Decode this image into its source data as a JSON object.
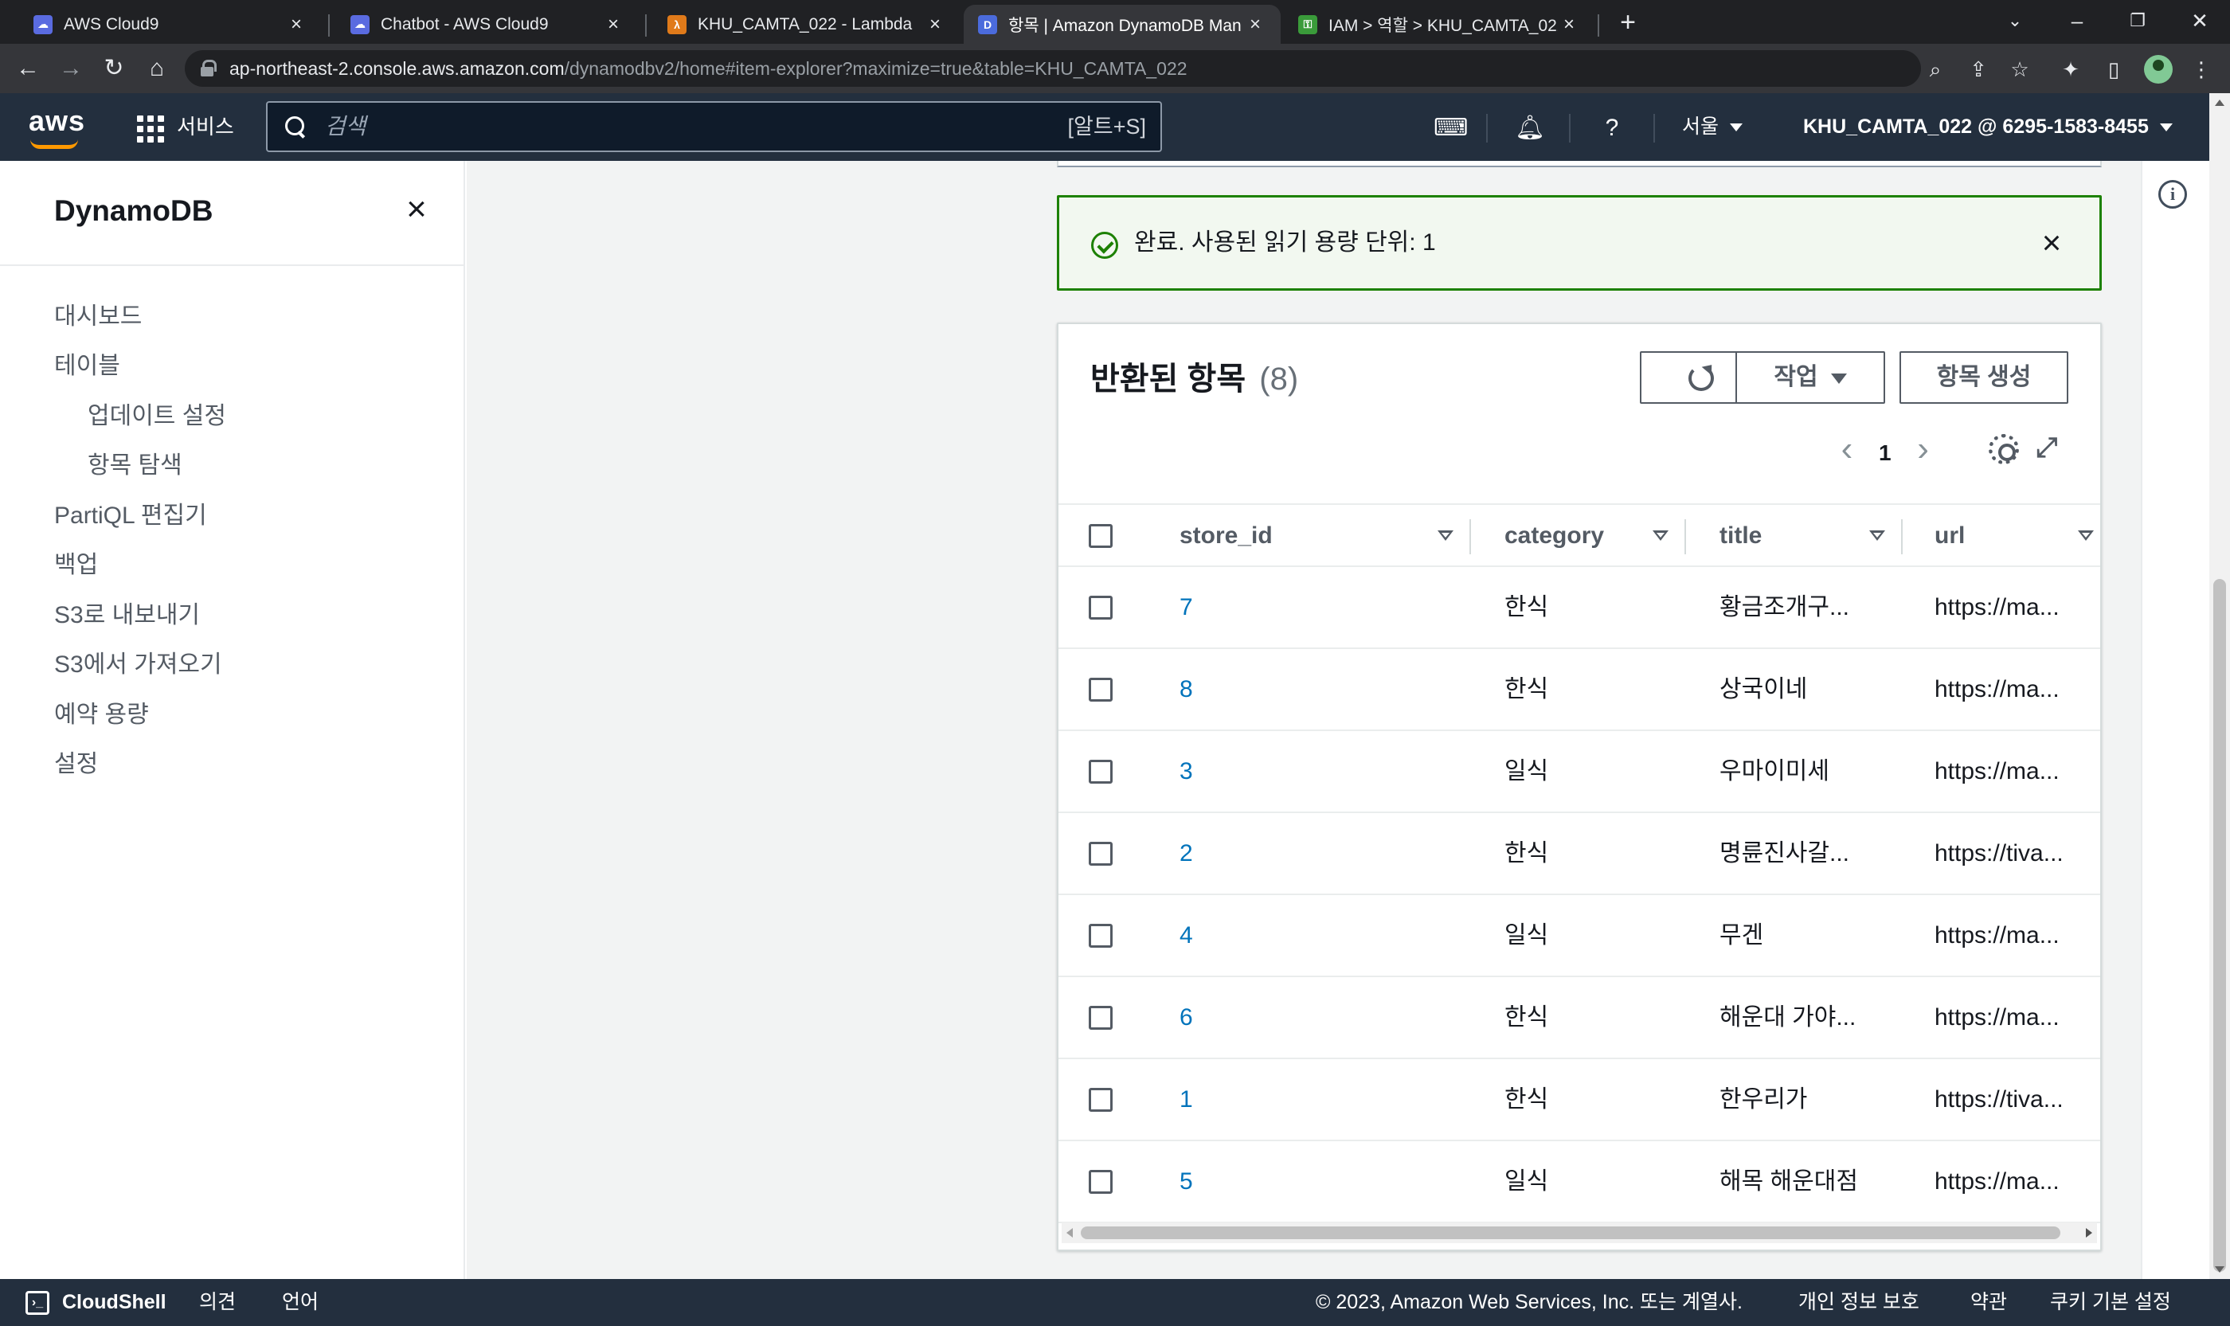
{
  "browser": {
    "tabs": [
      {
        "label": "AWS Cloud9",
        "favicon_color": "#5a6be0",
        "favicon": "☁"
      },
      {
        "label": "Chatbot - AWS Cloud9",
        "favicon_color": "#5a6be0",
        "favicon": "☁"
      },
      {
        "label": "KHU_CAMTA_022 - Lambda",
        "favicon_color": "#e07a1a",
        "favicon": "λ"
      },
      {
        "label": "항목 | Amazon DynamoDB Man",
        "favicon_color": "#4b6bdc",
        "favicon": "D"
      },
      {
        "label": "IAM > 역할 > KHU_CAMTA_022",
        "favicon_color": "#3a9b3a",
        "favicon": "⚿"
      }
    ],
    "url_host": "ap-northeast-2.console.aws.amazon.com",
    "url_path": "/dynamodbv2/home#item-explorer?maximize=true&table=KHU_CAMTA_022"
  },
  "aws": {
    "logo": "aws",
    "services_label": "서비스",
    "search_placeholder": "검색",
    "search_shortcut": "[알트+S]",
    "region": "서울",
    "account": "KHU_CAMTA_022 @ 6295-1583-8455"
  },
  "sidenav": {
    "title": "DynamoDB",
    "items": [
      {
        "label": "대시보드",
        "sub": false
      },
      {
        "label": "테이블",
        "sub": false
      },
      {
        "label": "업데이트 설정",
        "sub": true
      },
      {
        "label": "항목 탐색",
        "sub": true
      },
      {
        "label": "PartiQL 편집기",
        "sub": false
      },
      {
        "label": "백업",
        "sub": false
      },
      {
        "label": "S3로 내보내기",
        "sub": false
      },
      {
        "label": "S3에서 가져오기",
        "sub": false
      },
      {
        "label": "예약 용량",
        "sub": false
      },
      {
        "label": "설정",
        "sub": false
      }
    ]
  },
  "flash": {
    "message": "완료. 사용된 읽기 용량 단위: 1",
    "color": "#1d8102"
  },
  "panel": {
    "title": "반환된 항목",
    "count": "(8)",
    "actions_label": "작업",
    "create_label": "항목 생성",
    "page": "1"
  },
  "table": {
    "columns": [
      "store_id",
      "category",
      "title",
      "url"
    ],
    "rows": [
      {
        "store_id": "7",
        "category": "한식",
        "title": "황금조개구...",
        "url": "https://ma..."
      },
      {
        "store_id": "8",
        "category": "한식",
        "title": "상국이네",
        "url": "https://ma..."
      },
      {
        "store_id": "3",
        "category": "일식",
        "title": "우마이미세",
        "url": "https://ma..."
      },
      {
        "store_id": "2",
        "category": "한식",
        "title": "명륜진사갈...",
        "url": "https://tiva..."
      },
      {
        "store_id": "4",
        "category": "일식",
        "title": "무겐",
        "url": "https://ma..."
      },
      {
        "store_id": "6",
        "category": "한식",
        "title": "해운대 가야...",
        "url": "https://ma..."
      },
      {
        "store_id": "1",
        "category": "한식",
        "title": "한우리가",
        "url": "https://tiva..."
      },
      {
        "store_id": "5",
        "category": "일식",
        "title": "해목 해운대점",
        "url": "https://ma..."
      }
    ]
  },
  "footer": {
    "cloudshell": "CloudShell",
    "feedback": "의견",
    "language": "언어",
    "copyright": "© 2023, Amazon Web Services, Inc. 또는 계열사.",
    "privacy": "개인 정보 보호",
    "terms": "약관",
    "cookies": "쿠키 기본 설정"
  }
}
